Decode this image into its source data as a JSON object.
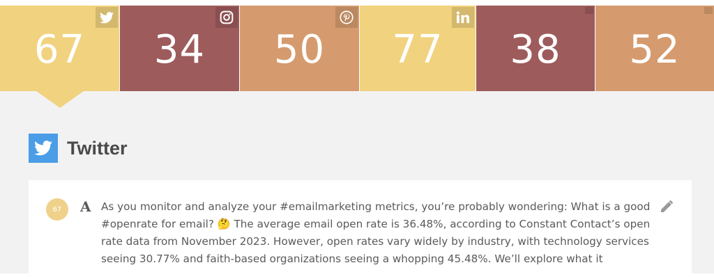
{
  "tiles": [
    {
      "network": "twitter",
      "score": "67",
      "color": "#f1d27e",
      "icon": "twitter-icon"
    },
    {
      "network": "instagram",
      "score": "34",
      "color": "#9e5b5c",
      "icon": "instagram-icon"
    },
    {
      "network": "pinterest",
      "score": "50",
      "color": "#d59b6e",
      "icon": "pinterest-icon"
    },
    {
      "network": "linkedin",
      "score": "77",
      "color": "#f1d27e",
      "icon": "linkedin-icon"
    },
    {
      "network": "unlabeled",
      "score": "38",
      "color": "#9e5b5c"
    },
    {
      "network": "unlabeled",
      "score": "52",
      "color": "#d59b6e"
    }
  ],
  "section": {
    "title": "Twitter",
    "icon": "twitter-icon",
    "icon_color": "#4a9de6"
  },
  "post": {
    "score": "67",
    "font_glyph": "A",
    "text": "As you monitor and analyze your #emailmarketing metrics, you’re probably wondering: What is a good #openrate for email? 🤔 The average email open rate is 36.48%, according to Constant Contact’s open rate data from November 2023. However, open rates vary widely by industry, with technology services seeing 30.77% and faith-based organizations seeing a whopping 45.48%. We’ll explore what it"
  }
}
